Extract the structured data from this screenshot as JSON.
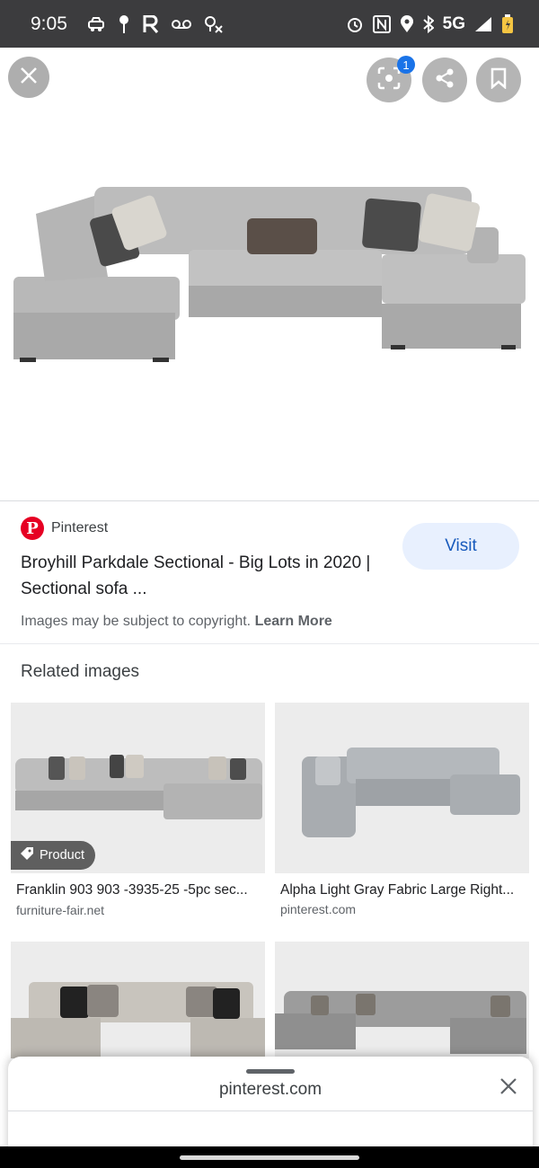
{
  "status_bar": {
    "time": "9:05",
    "left_icons": [
      "car-icon",
      "tree-icon",
      "r-app-icon",
      "voicemail-icon",
      "location-off-icon"
    ],
    "right_icons": [
      "alarm-icon",
      "nfc-icon",
      "location-icon",
      "bluetooth-icon",
      "signal-icon",
      "battery-icon"
    ],
    "network": "5G"
  },
  "hero": {
    "lens_badge": "1",
    "icons": [
      "close-icon",
      "lens-icon",
      "share-icon",
      "bookmark-icon"
    ]
  },
  "result": {
    "source": "Pinterest",
    "title": "Broyhill Parkdale Sectional - Big Lots in 2020 | Sectional sofa ...",
    "visit_label": "Visit",
    "copyright_text": "Images may be subject to copyright.",
    "learn_more": "Learn More"
  },
  "related": {
    "heading": "Related images",
    "items": [
      {
        "title": "Franklin 903 903 -3935-25 -5pc sec...",
        "domain": "furniture-fair.net",
        "chip": "Product"
      },
      {
        "title": "Alpha Light Gray Fabric Large Right...",
        "domain": "pinterest.com"
      },
      {
        "title": "",
        "domain": ""
      },
      {
        "title": "",
        "domain": ""
      }
    ]
  },
  "bottom_sheet": {
    "title": "pinterest.com"
  },
  "colors": {
    "accent": "#1a73e8",
    "visit_bg": "#e8f0fe",
    "pinterest_red": "#e60023",
    "status_bar_bg": "#3c3c3e"
  }
}
